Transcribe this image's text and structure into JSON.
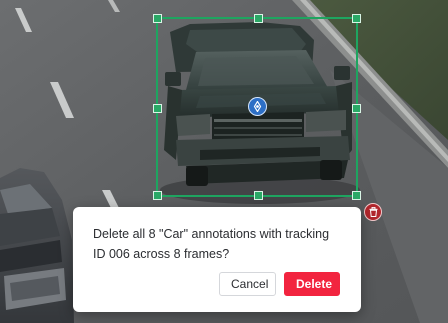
{
  "dialog": {
    "message": "Delete all 8 \"Car\" annotations with tracking ID 006 across 8 frames?",
    "cancel_label": "Cancel",
    "delete_label": "Delete"
  },
  "annotation": {
    "box_color": "#1ea560",
    "center_handle_icon": "move-icon",
    "delete_icon": "trash-icon"
  },
  "colors": {
    "danger": "#f2243f",
    "accent": "#2d6fc6"
  }
}
